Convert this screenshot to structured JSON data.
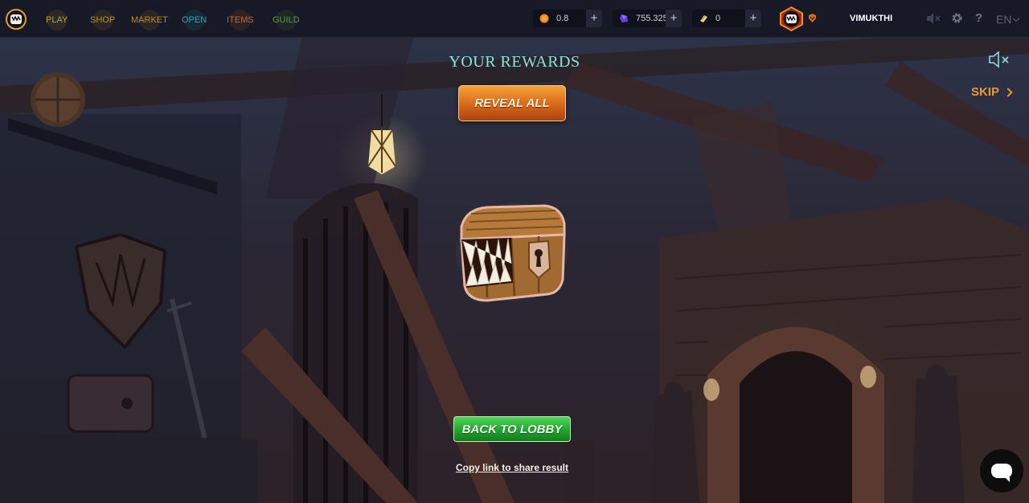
{
  "nav": {
    "items": [
      {
        "label": "PLAY",
        "color": "#c4a22c"
      },
      {
        "label": "SHOP",
        "color": "#c0892a"
      },
      {
        "label": "MARKET",
        "color": "#c0892a"
      },
      {
        "label": "OPEN",
        "color": "#2aa4b8"
      },
      {
        "label": "ITEMS",
        "color": "#c06a2a"
      },
      {
        "label": "GUILD",
        "color": "#5c9c3a"
      }
    ]
  },
  "balances": {
    "coin": {
      "value": "0.8",
      "icon": "gold-coin-icon"
    },
    "gems": {
      "value": "755.325",
      "icon": "purple-gem-icon"
    },
    "tickets": {
      "value": "0",
      "icon": "ticket-icon"
    },
    "add_symbol": "+"
  },
  "user": {
    "username": "VIMUKTHI",
    "avatar_icon": "chest-monster-avatar-icon",
    "rank_icon": "rank-badge-icon"
  },
  "header_tools": {
    "sound_icon": "speaker-muted-icon",
    "settings_icon": "gear-icon",
    "help_label": "?",
    "language": "EN"
  },
  "main": {
    "title": "YOUR REWARDS",
    "reveal_label": "REVEAL ALL",
    "skip_label": "SKIP",
    "back_label": "BACK TO LOBBY",
    "share_label": "Copy link to share result",
    "chest_icon": "monster-treasure-chest-icon"
  },
  "colors": {
    "accent_orange": "#e69a2c",
    "title_teal": "#8fe0dc",
    "button_green": "#21a52e",
    "topbar_bg": "#171926"
  }
}
